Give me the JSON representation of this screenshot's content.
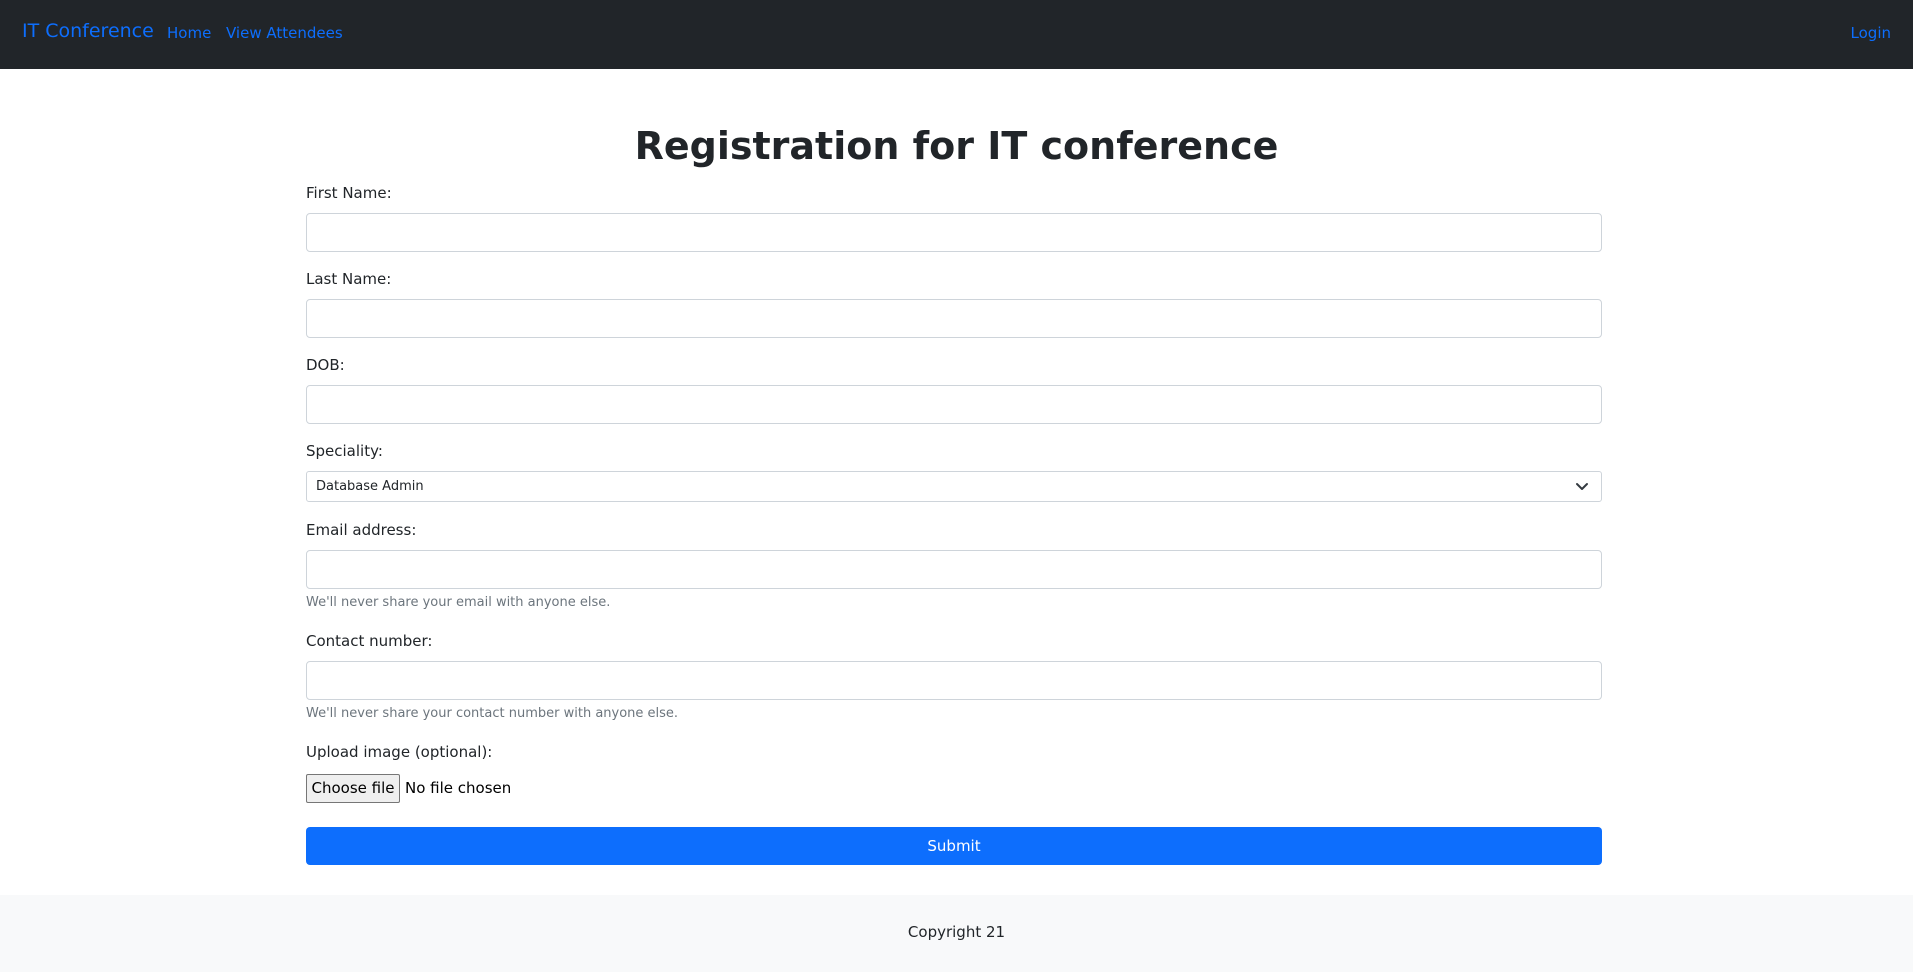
{
  "navbar": {
    "brand": "IT Conference",
    "links": [
      "Home",
      "View Attendees"
    ],
    "login": "Login"
  },
  "page": {
    "title": "Registration for IT conference"
  },
  "form": {
    "first_name_label": "First Name:",
    "last_name_label": "Last Name:",
    "dob_label": "DOB:",
    "speciality_label": "Speciality:",
    "speciality_selected": "Database Admin",
    "email_label": "Email address:",
    "email_help": "We'll never share your email with anyone else.",
    "contact_label": "Contact number:",
    "contact_help": "We'll never share your contact number with anyone else.",
    "upload_label": "Upload image (optional):",
    "choose_file": "Choose file",
    "file_status": "No file chosen",
    "submit": "Submit"
  },
  "footer": {
    "text": "Copyright 21"
  },
  "colors": {
    "navbar_bg": "#212529",
    "link": "#0d6efd",
    "primary": "#0d6efd",
    "footer_bg": "#f8f9fa",
    "help_text": "#6c757d"
  },
  "icons": {
    "select_arrow": "chevron-down-icon"
  }
}
